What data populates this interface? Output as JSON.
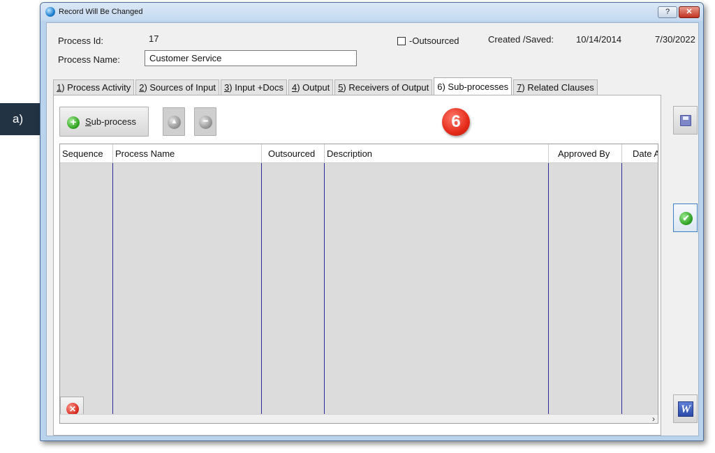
{
  "callout": {
    "label": "a)"
  },
  "window": {
    "title": "Record Will Be Changed",
    "help_label": "?",
    "close_label": "✕"
  },
  "header": {
    "process_id_label": "Process Id:",
    "process_id_value": "17",
    "process_name_label": "Process Name:",
    "process_name_value": "Customer Service",
    "outsourced_label": "-Outsourced",
    "outsourced_checked": false,
    "created_saved_label": "Created /Saved:",
    "created_date": "10/14/2014",
    "saved_date": "7/30/2022"
  },
  "tabs": [
    {
      "key": "1",
      "rest": ") Process Activity"
    },
    {
      "key": "2",
      "rest": ") Sources of Input"
    },
    {
      "key": "3",
      "rest": ") Input +Docs"
    },
    {
      "key": "4",
      "rest": ") Output"
    },
    {
      "key": "5",
      "rest": ") Receivers of Output"
    },
    {
      "key": "6",
      "rest": ") Sub-processes",
      "active": true
    },
    {
      "key": "7",
      "rest": ") Related Clauses"
    }
  ],
  "toolbar": {
    "add_subprocess_key": "S",
    "add_subprocess_rest": "ub-process",
    "step_badge": "6"
  },
  "grid": {
    "columns": [
      {
        "label": "Sequence"
      },
      {
        "label": "Process Name"
      },
      {
        "label": "Outsourced"
      },
      {
        "label": "Description"
      },
      {
        "label": "Approved By"
      },
      {
        "label": "Date Approved"
      }
    ],
    "rows": []
  },
  "icons": {
    "app": "app-icon",
    "add": "plus-circle-icon",
    "move_up": "triangle-up-icon",
    "remove": "minus-circle-icon",
    "delete": "red-x-icon",
    "save": "floppy-disk-icon",
    "confirm": "green-check-icon",
    "word_export": "word-icon"
  },
  "colors": {
    "window_frame": "#b9d3ec",
    "badge_red": "#e52b1a",
    "grid_line": "#2a2a9a",
    "callout_bg": "#223344"
  }
}
